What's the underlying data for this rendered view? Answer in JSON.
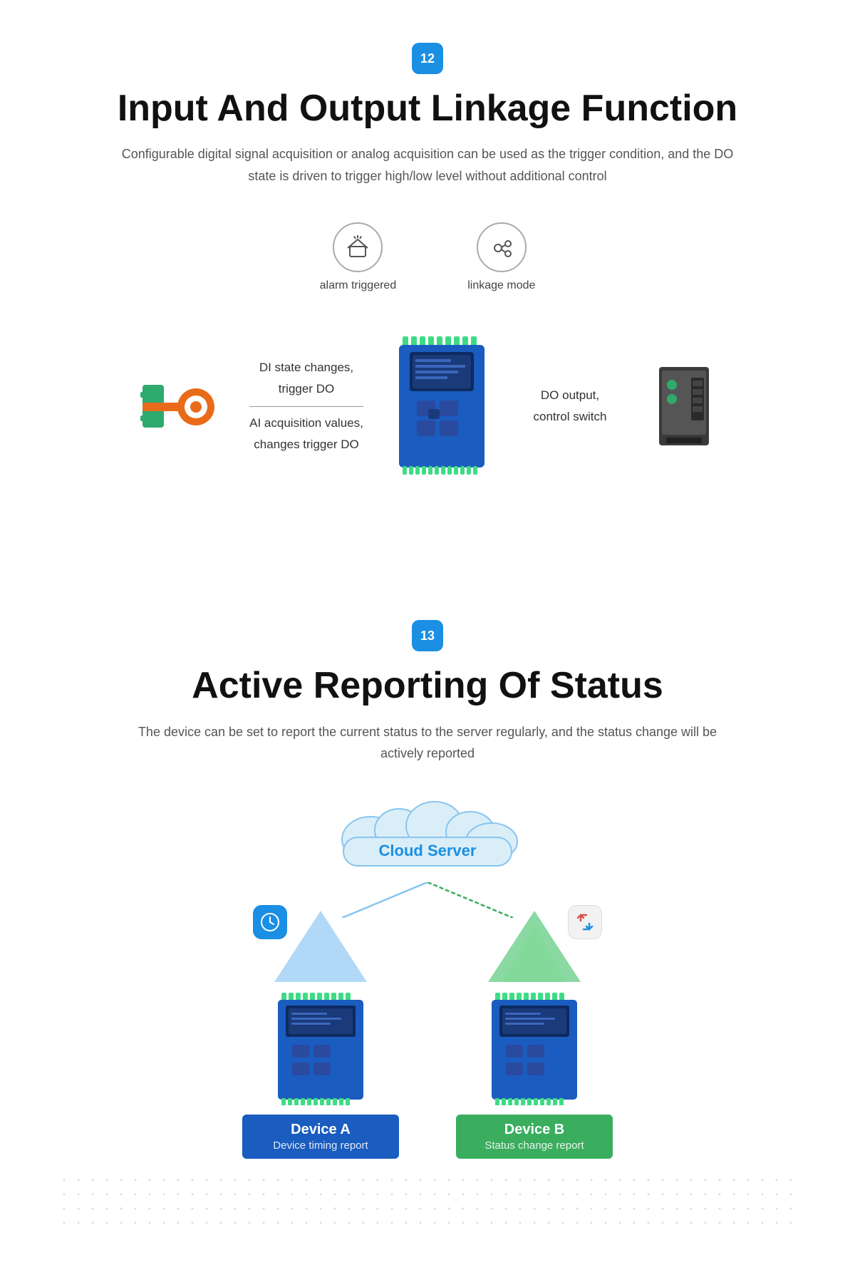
{
  "section12": {
    "badge": "12",
    "title": "Input And Output Linkage Function",
    "subtitle": "Configurable digital signal acquisition or analog  acquisition can be used as the trigger condition, and the DO state is driven to trigger high/low level without additional control",
    "icons": [
      {
        "id": "alarm-triggered",
        "label": "alarm triggered"
      },
      {
        "id": "linkage-mode",
        "label": "linkage mode"
      }
    ],
    "left_labels": {
      "line1": "DI state changes,",
      "line2": "trigger DO",
      "line3": "AI acquisition values,",
      "line4": "changes trigger DO"
    },
    "right_labels": {
      "line1": "DO output,",
      "line2": "control switch"
    }
  },
  "section13": {
    "badge": "13",
    "title": "Active Reporting Of Status",
    "subtitle": "The device can be set to report the current status to the server regularly,\n and the status change will be actively reported",
    "cloud_label": "Cloud Server",
    "device_a": {
      "name": "Device A",
      "desc": "Device timing report"
    },
    "device_b": {
      "name": "Device B",
      "desc": "Status change report"
    }
  }
}
